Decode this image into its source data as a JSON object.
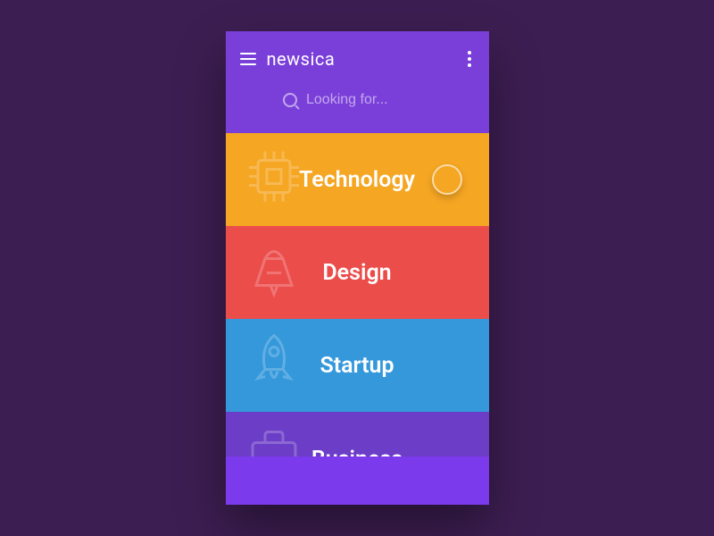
{
  "header": {
    "title": "newsica"
  },
  "search": {
    "placeholder": "Looking for..."
  },
  "categories": [
    {
      "label": "Technology",
      "icon": "chip-icon",
      "color": "#f5a623"
    },
    {
      "label": "Design",
      "icon": "pencil-icon",
      "color": "#eb4d4b"
    },
    {
      "label": "Startup",
      "icon": "rocket-icon",
      "color": "#3498db"
    },
    {
      "label": "Business",
      "icon": "briefcase-icon",
      "color": "#6c3dc7"
    }
  ]
}
